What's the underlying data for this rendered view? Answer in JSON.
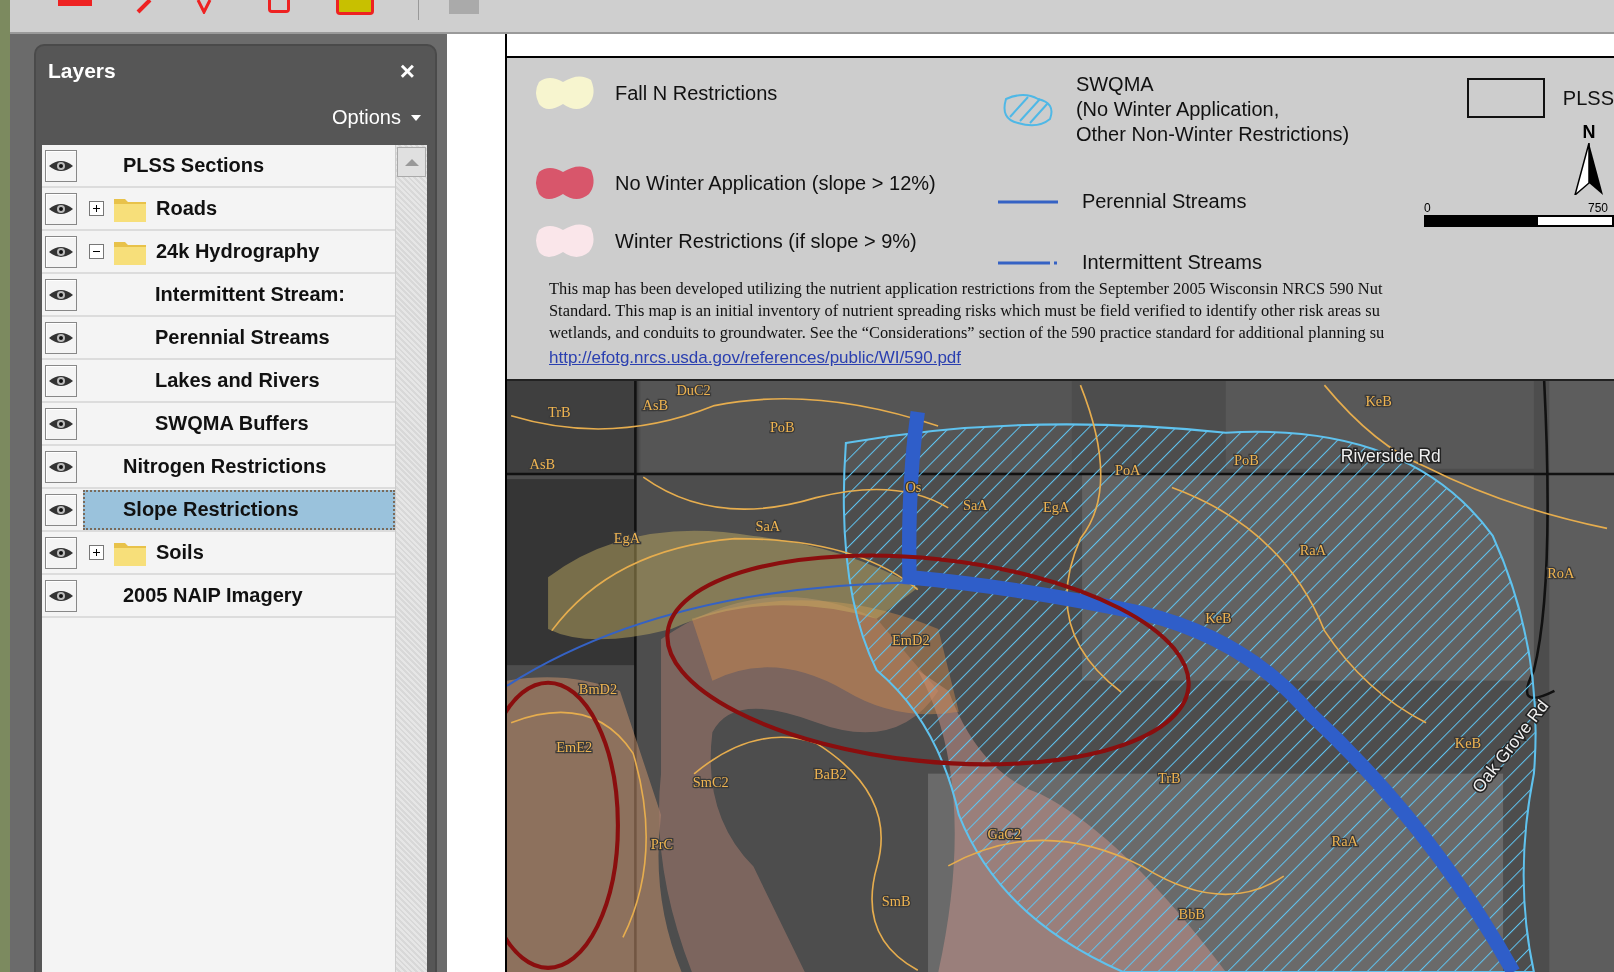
{
  "layers_panel": {
    "title": "Layers",
    "close": "×",
    "options": "Options",
    "items": [
      {
        "label": "PLSS Sections",
        "kind": "layer",
        "visible": true,
        "selected": false
      },
      {
        "label": "Roads",
        "kind": "folder",
        "visible": true,
        "selected": false,
        "expanded": false
      },
      {
        "label": "24k Hydrography",
        "kind": "folder",
        "visible": true,
        "selected": false,
        "expanded": true,
        "children": [
          {
            "label": "Intermittent Stream:",
            "kind": "layer",
            "visible": true,
            "selected": false
          },
          {
            "label": "Perennial Streams",
            "kind": "layer",
            "visible": true,
            "selected": false
          },
          {
            "label": "Lakes and Rivers",
            "kind": "layer",
            "visible": true,
            "selected": false
          },
          {
            "label": "SWQMA Buffers",
            "kind": "layer",
            "visible": true,
            "selected": false
          }
        ]
      },
      {
        "label": "Nitrogen Restrictions",
        "kind": "layer",
        "visible": true,
        "selected": false
      },
      {
        "label": "Slope Restrictions",
        "kind": "layer",
        "visible": true,
        "selected": true
      },
      {
        "label": "Soils",
        "kind": "folder",
        "visible": true,
        "selected": false,
        "expanded": false
      },
      {
        "label": "2005 NAIP Imagery",
        "kind": "layer",
        "visible": true,
        "selected": false
      }
    ]
  },
  "legend": {
    "items": [
      {
        "kind": "patch",
        "label": "Fall N Restrictions",
        "color": "#f7f5cf"
      },
      {
        "kind": "patch",
        "label": "No Winter Application (slope > 12%)",
        "color": "#d8566b"
      },
      {
        "kind": "patch",
        "label": "Winter Restrictions (if slope > 9%)",
        "color": "#fae6ea"
      },
      {
        "kind": "hatch",
        "label": "SWQMA\n(No Winter Application,\nOther Non-Winter Restrictions)",
        "color": "#4fb8e6"
      },
      {
        "kind": "line",
        "label": "Perennial Streams",
        "color": "#3562c4"
      },
      {
        "kind": "dashed-line",
        "label": "Intermittent Streams",
        "color": "#3562c4"
      },
      {
        "kind": "outline",
        "label": "PLSS"
      }
    ],
    "north": "N",
    "scale_start": "0",
    "scale_end": "750",
    "note_lines": [
      "This map has been developed utilizing the nutrient application restrictions from the September 2005 Wisconsin NRCS 590 Nut",
      "Standard. This map is an initial inventory of nutrient spreading risks which must be field verified to identify other risk areas su",
      "wetlands, and conduits to groundwater. See the “Considerations” section of the 590 practice standard for additional planning su"
    ],
    "link": "http://efotg.nrcs.usda.gov/references/public/WI/590.pdf"
  },
  "map": {
    "labels": [
      {
        "text": "TrB",
        "kind": "soil"
      },
      {
        "text": "AsB",
        "kind": "soil"
      },
      {
        "text": "DuC2",
        "kind": "soil"
      },
      {
        "text": "PoB",
        "kind": "soil"
      },
      {
        "text": "AsB",
        "kind": "soil"
      },
      {
        "text": "KeB",
        "kind": "soil"
      },
      {
        "text": "PoA",
        "kind": "soil"
      },
      {
        "text": "PoB",
        "kind": "soil"
      },
      {
        "text": "Riverside Rd",
        "kind": "road"
      },
      {
        "text": "Os",
        "kind": "soil"
      },
      {
        "text": "SaA",
        "kind": "soil"
      },
      {
        "text": "EgA",
        "kind": "soil"
      },
      {
        "text": "SaA",
        "kind": "soil"
      },
      {
        "text": "EgA",
        "kind": "soil"
      },
      {
        "text": "RaA",
        "kind": "soil"
      },
      {
        "text": "RoA",
        "kind": "soil"
      },
      {
        "text": "KeB",
        "kind": "soil"
      },
      {
        "text": "EmD2",
        "kind": "soil"
      },
      {
        "text": "BmD2",
        "kind": "soil"
      },
      {
        "text": "EmE2",
        "kind": "soil"
      },
      {
        "text": "SmC2",
        "kind": "soil"
      },
      {
        "text": "BaB2",
        "kind": "soil"
      },
      {
        "text": "KeB",
        "kind": "soil"
      },
      {
        "text": "Oak Grove Rd",
        "kind": "road"
      },
      {
        "text": "TrB",
        "kind": "soil"
      },
      {
        "text": "PrC",
        "kind": "soil"
      },
      {
        "text": "GaC2",
        "kind": "soil"
      },
      {
        "text": "RaA",
        "kind": "soil"
      },
      {
        "text": "SmB",
        "kind": "soil"
      },
      {
        "text": "BbB",
        "kind": "soil"
      }
    ]
  }
}
